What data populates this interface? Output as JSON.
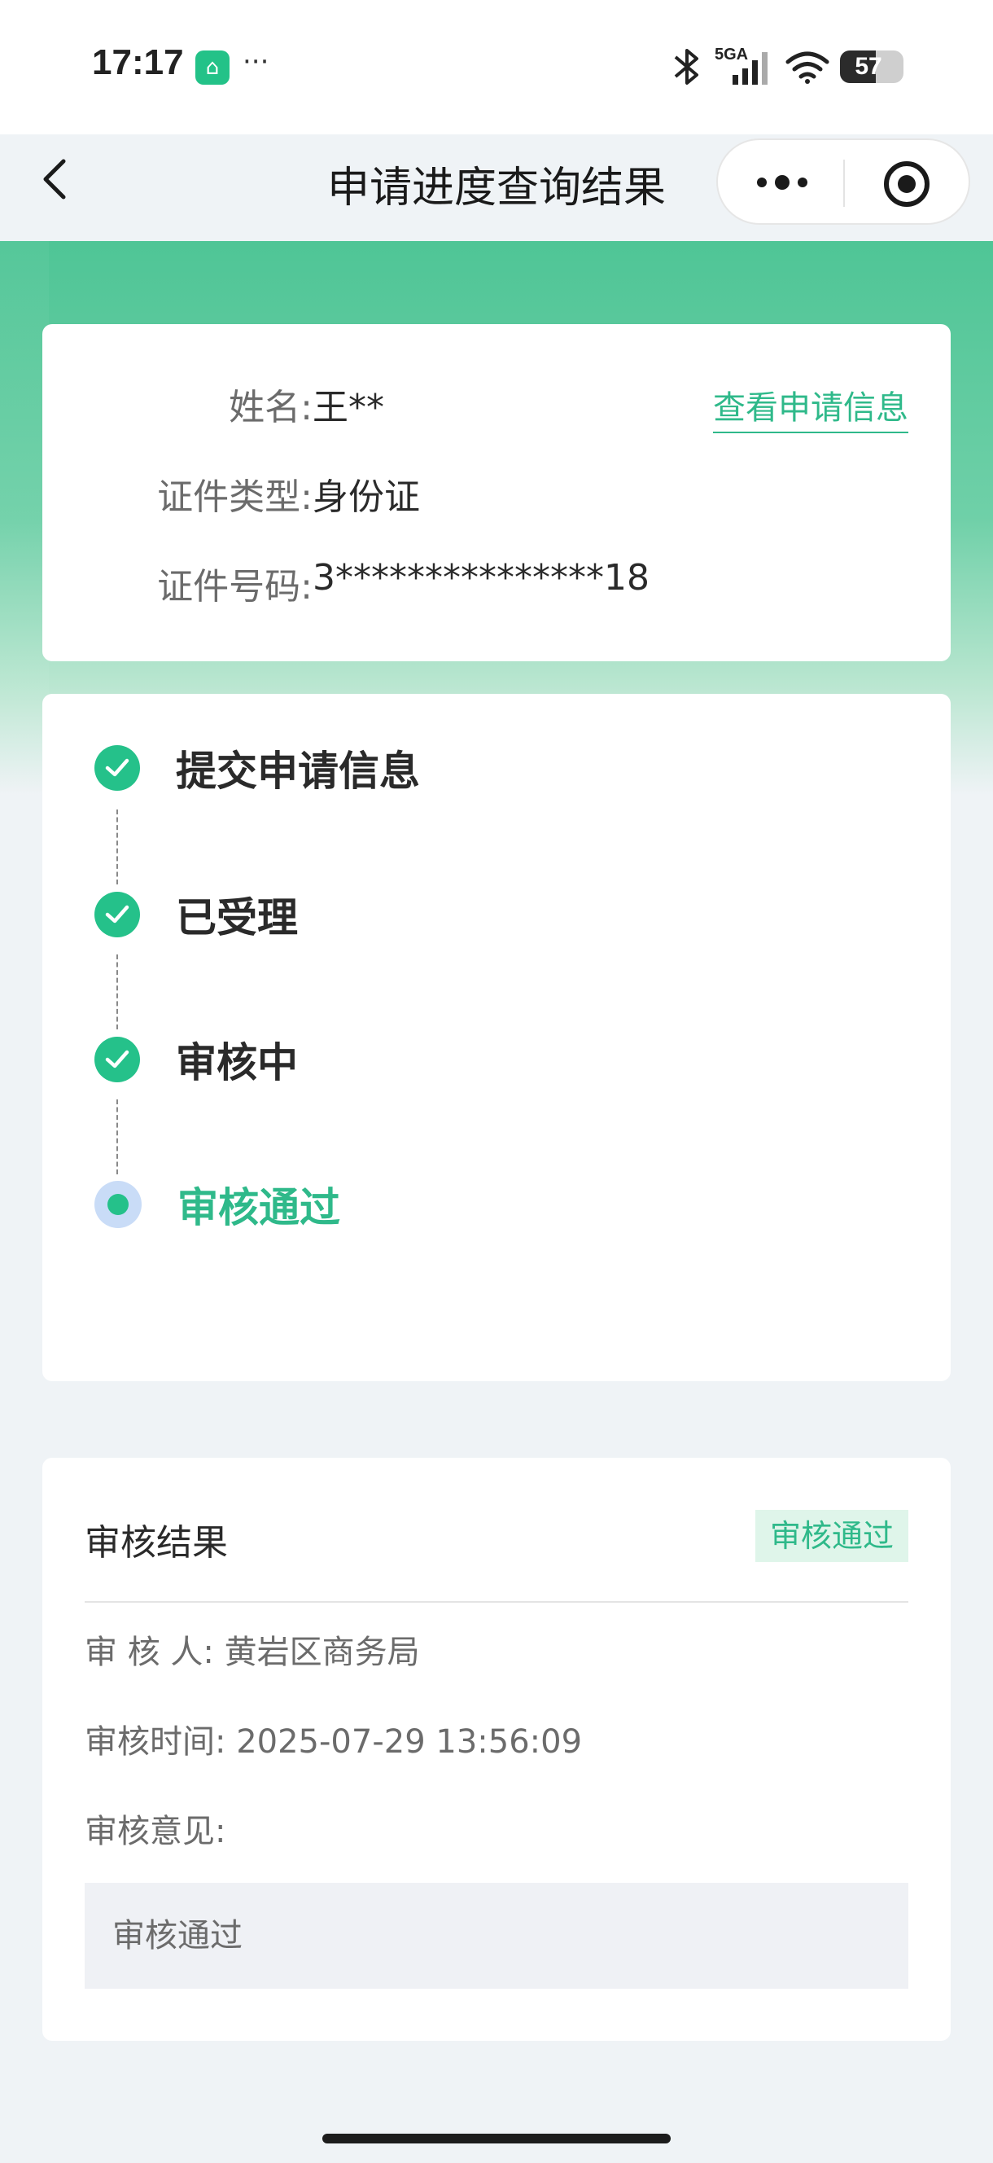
{
  "status_bar": {
    "time": "17:17",
    "app_icon": "mi-home-icon",
    "overflow": "···",
    "network": "5GA",
    "battery": "57"
  },
  "nav": {
    "title": "申请进度查询结果"
  },
  "applicant": {
    "name_label": "姓名:",
    "name_value": "王**",
    "id_type_label": "证件类型:",
    "id_type_value": "身份证",
    "id_number_label": "证件号码:",
    "id_number_value": "3***************18",
    "view_link": "查看申请信息"
  },
  "progress": {
    "steps": [
      {
        "label": "提交申请信息",
        "status": "done"
      },
      {
        "label": "已受理",
        "status": "done"
      },
      {
        "label": "审核中",
        "status": "done"
      },
      {
        "label": "审核通过",
        "status": "current"
      }
    ]
  },
  "result": {
    "title": "审核结果",
    "badge": "审核通过",
    "reviewer_label": "审 核 人:",
    "reviewer_value": "黄岩区商务局",
    "time_label": "审核时间:",
    "time_value": "2025-07-29 13:56:09",
    "opinion_label": "审核意见:",
    "opinion_value": "审核通过"
  },
  "colors": {
    "accent": "#25c18a",
    "link": "#2fb98a",
    "banner": "#4fc596",
    "badge_bg": "#dff5ea"
  }
}
